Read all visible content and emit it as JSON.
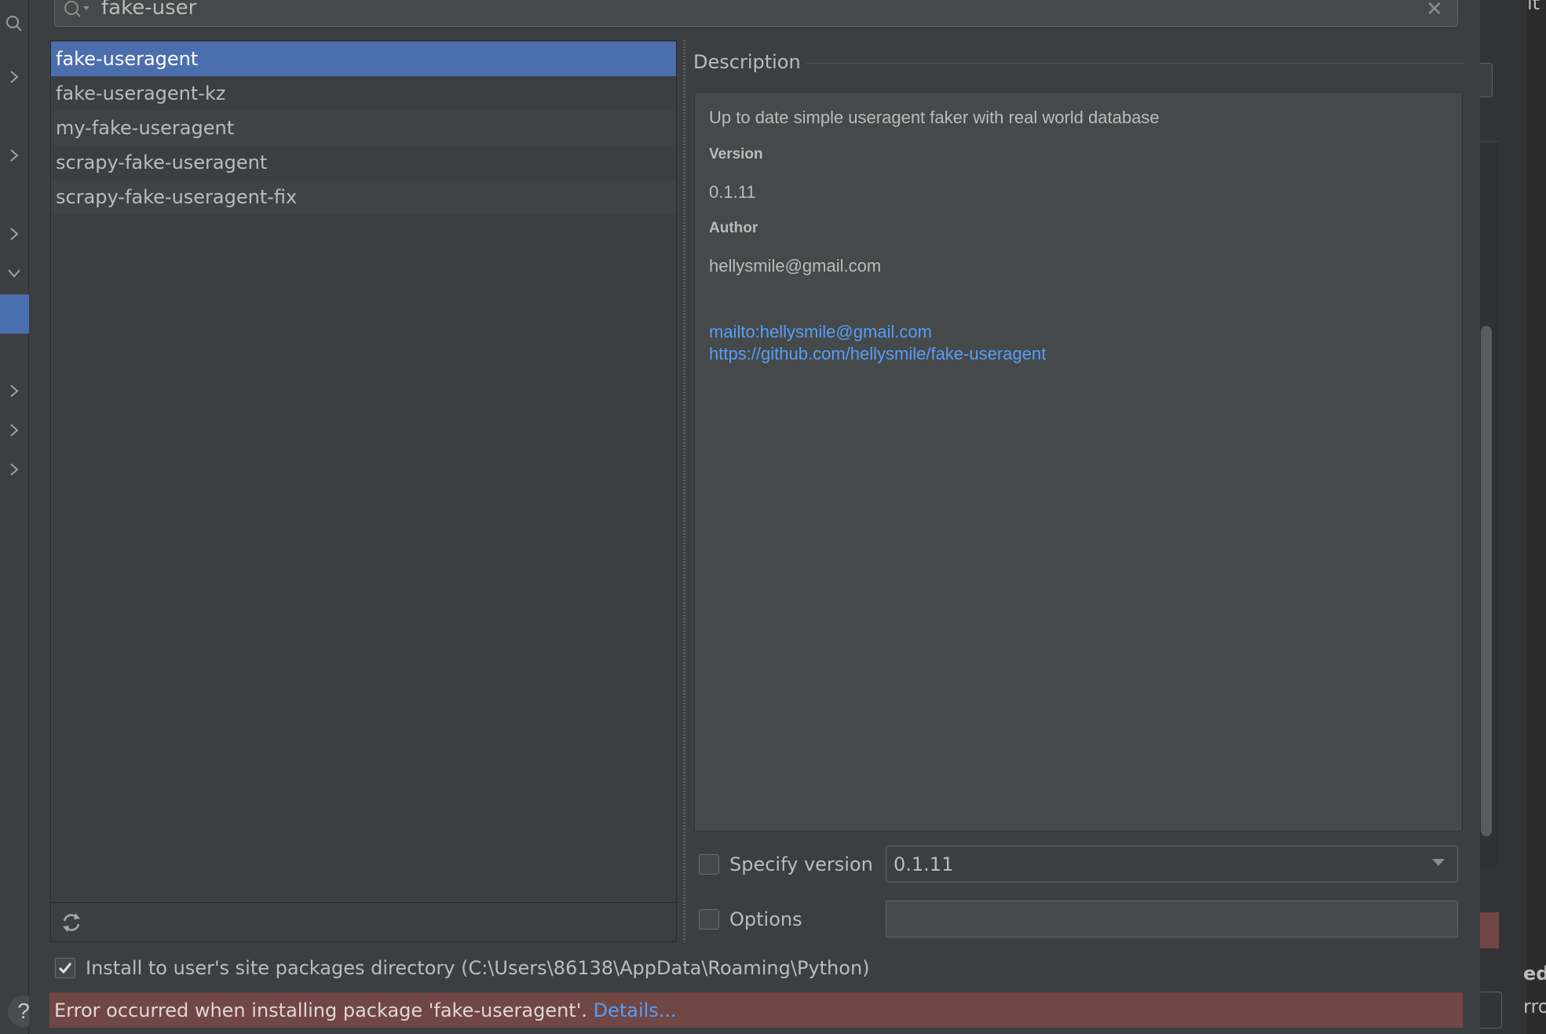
{
  "search": {
    "value": "fake-user"
  },
  "packages": [
    {
      "name": "fake-useragent",
      "selected": true
    },
    {
      "name": "fake-useragent-kz",
      "selected": false
    },
    {
      "name": "my-fake-useragent",
      "selected": false
    },
    {
      "name": "scrapy-fake-useragent",
      "selected": false
    },
    {
      "name": "scrapy-fake-useragent-fix",
      "selected": false
    }
  ],
  "description": {
    "title": "Description",
    "summary": "Up to date simple useragent faker with real world database",
    "version_label": "Version",
    "version_value": "0.1.11",
    "author_label": "Author",
    "author_value": "hellysmile@gmail.com",
    "links": [
      "mailto:hellysmile@gmail.com",
      "https://github.com/hellysmile/fake-useragent"
    ]
  },
  "controls": {
    "specify_version_label": "Specify version",
    "specify_version_checked": false,
    "version_selected": "0.1.11",
    "options_label": "Options",
    "options_checked": false,
    "options_value": "",
    "install_user_label": "Install to user's site packages directory (C:\\Users\\86138\\AppData\\Roaming\\Python)",
    "install_user_checked": true
  },
  "error": {
    "message": "Error occurred when installing package 'fake-useragent'.",
    "details_link": "Details..."
  },
  "background_window": {
    "fragment_top": "it",
    "fragment_ed": "ed",
    "fragment_rrc": "rro"
  },
  "help_button": "?",
  "colors": {
    "background": "#3c3f41",
    "selection": "#4b6eaf",
    "link": "#589df6",
    "error_bar": "#704745"
  }
}
